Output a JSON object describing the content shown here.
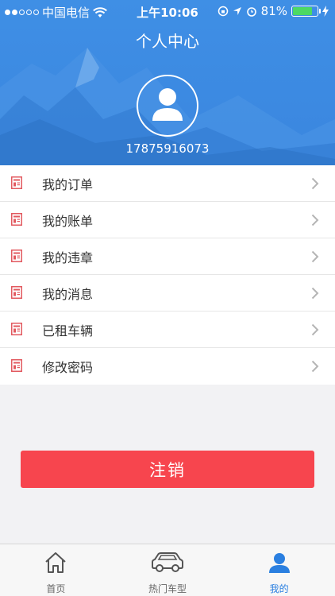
{
  "status_bar": {
    "carrier": "中国电信",
    "time": "上午10:06",
    "battery": "81%",
    "battery_level": 0.81
  },
  "header": {
    "title": "个人中心",
    "phone": "17875916073"
  },
  "menu": [
    {
      "label": "我的订单"
    },
    {
      "label": "我的账单"
    },
    {
      "label": "我的违章"
    },
    {
      "label": "我的消息"
    },
    {
      "label": "已租车辆"
    },
    {
      "label": "修改密码"
    }
  ],
  "logout_label": "注销",
  "tabs": [
    {
      "label": "首页",
      "icon": "home-icon"
    },
    {
      "label": "热门车型",
      "icon": "car-icon"
    },
    {
      "label": "我的",
      "icon": "user-icon",
      "active": true
    }
  ],
  "colors": {
    "header": "#3a86df",
    "accent": "#2a7fe0",
    "logout": "#f7454e",
    "menu_icon": "#e2595f"
  }
}
